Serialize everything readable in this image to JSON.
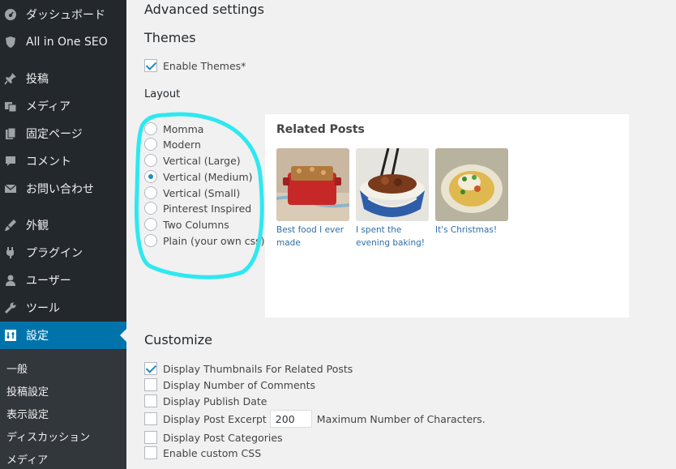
{
  "sidebar": {
    "items": [
      {
        "label": "ダッシュボード",
        "icon": "dashboard-icon"
      },
      {
        "label": "All in One SEO",
        "icon": "shield-icon"
      },
      {
        "label": "投稿",
        "icon": "pin-icon"
      },
      {
        "label": "メディア",
        "icon": "media-icon"
      },
      {
        "label": "固定ページ",
        "icon": "pages-icon"
      },
      {
        "label": "コメント",
        "icon": "comment-icon"
      },
      {
        "label": "お問い合わせ",
        "icon": "mail-icon"
      },
      {
        "label": "外観",
        "icon": "appearance-icon"
      },
      {
        "label": "プラグイン",
        "icon": "plugin-icon"
      },
      {
        "label": "ユーザー",
        "icon": "user-icon"
      },
      {
        "label": "ツール",
        "icon": "wrench-icon"
      },
      {
        "label": "設定",
        "icon": "settings-icon",
        "active": true
      }
    ],
    "submenu": [
      "一般",
      "投稿設定",
      "表示設定",
      "ディスカッション",
      "メディア"
    ]
  },
  "main": {
    "advanced_title": "Advanced settings",
    "themes_title": "Themes",
    "enable_themes": {
      "label": "Enable Themes*",
      "checked": true
    },
    "layout_label": "Layout",
    "layout_options": [
      {
        "label": "Momma",
        "selected": false
      },
      {
        "label": "Modern",
        "selected": false
      },
      {
        "label": "Vertical (Large)",
        "selected": false
      },
      {
        "label": "Vertical (Medium)",
        "selected": true
      },
      {
        "label": "Vertical (Small)",
        "selected": false
      },
      {
        "label": "Pinterest Inspired",
        "selected": false
      },
      {
        "label": "Two Columns",
        "selected": false
      },
      {
        "label": "Plain (your own css)",
        "selected": false
      }
    ],
    "preview": {
      "title": "Related Posts",
      "posts": [
        {
          "caption": "Best food I ever made"
        },
        {
          "caption": "I spent the evening baking!"
        },
        {
          "caption": "It's Christmas!"
        }
      ]
    },
    "customize_title": "Customize",
    "customize_options": [
      {
        "label": "Display Thumbnails For Related Posts",
        "checked": true
      },
      {
        "label": "Display Number of Comments",
        "checked": false
      },
      {
        "label": "Display Publish Date",
        "checked": false
      },
      {
        "label": "Display Post Excerpt",
        "checked": false,
        "value": "200",
        "suffix": "Maximum Number of Characters."
      },
      {
        "label": "Display Post Categories",
        "checked": false
      },
      {
        "label": "Enable custom CSS",
        "checked": false
      }
    ]
  },
  "colors": {
    "sidebar_bg": "#23282d",
    "active_menu": "#0073aa",
    "page_bg": "#f1f1f1",
    "link": "#2e6ea6",
    "annotation": "#2ee8f0"
  }
}
